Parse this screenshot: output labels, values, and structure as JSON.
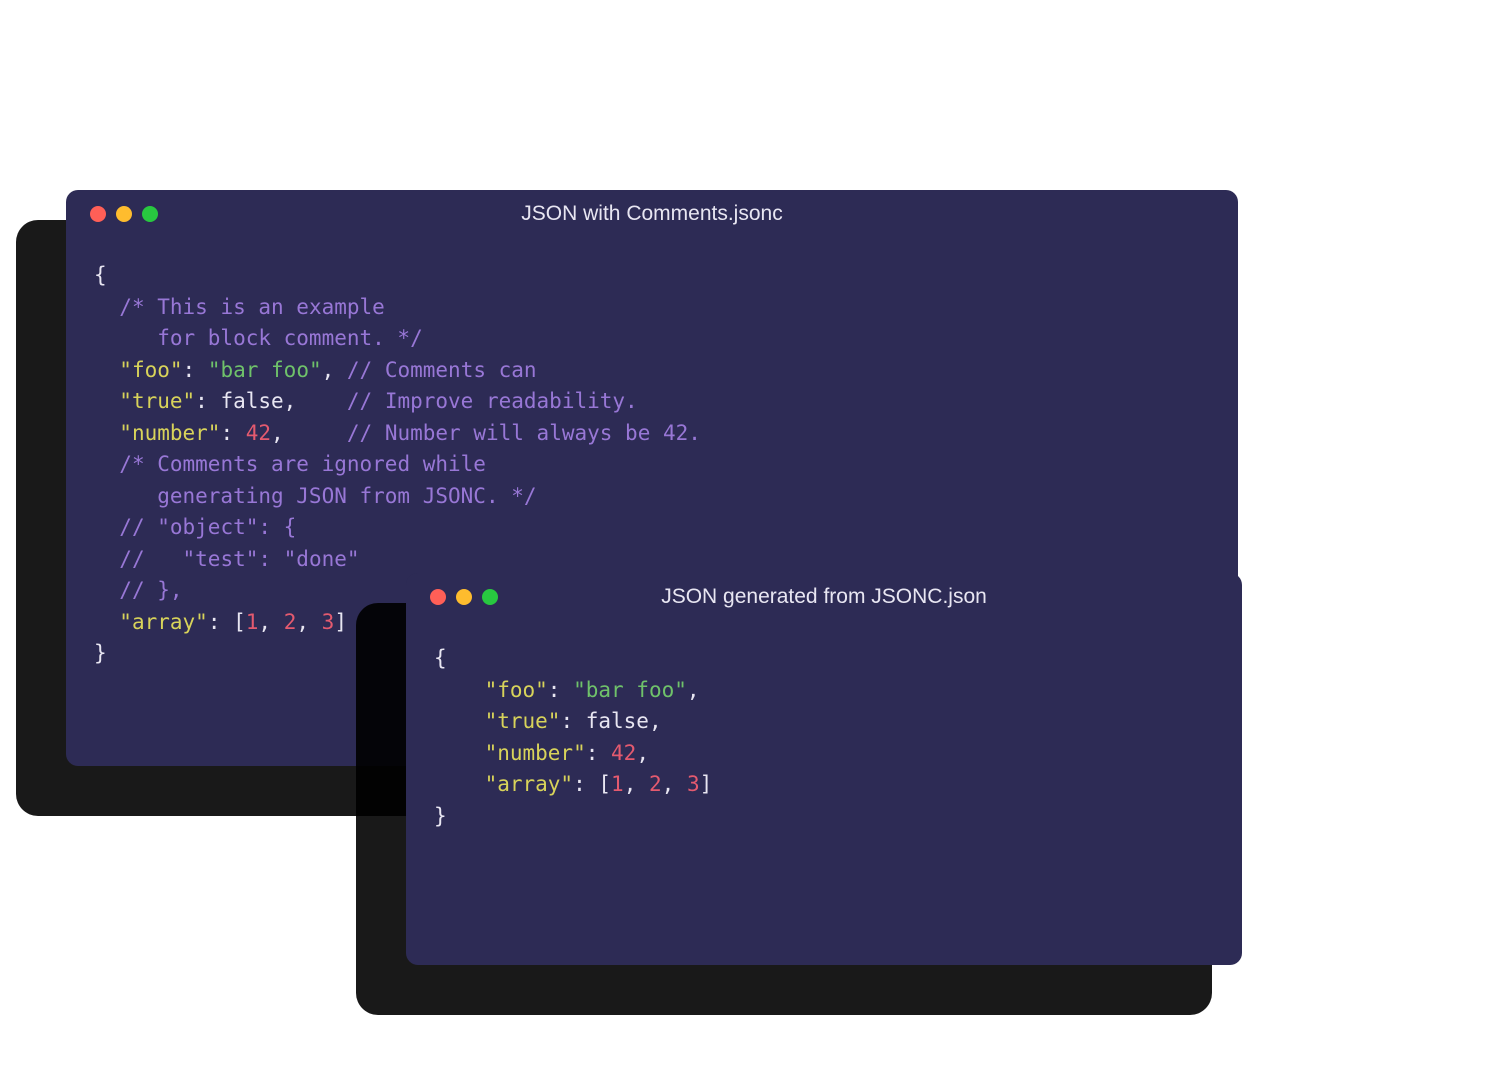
{
  "windows": {
    "back": {
      "title": "JSON with Comments.jsonc",
      "tokens": [
        [
          {
            "c": "t-punct",
            "t": "{"
          }
        ],
        [
          {
            "c": "t-punct",
            "t": "  "
          },
          {
            "c": "t-comment",
            "t": "/* This is an example"
          }
        ],
        [
          {
            "c": "t-punct",
            "t": "     "
          },
          {
            "c": "t-comment",
            "t": "for block comment. */"
          }
        ],
        [
          {
            "c": "t-punct",
            "t": "  "
          },
          {
            "c": "t-key",
            "t": "\"foo\""
          },
          {
            "c": "t-punct",
            "t": ": "
          },
          {
            "c": "t-string",
            "t": "\"bar foo\""
          },
          {
            "c": "t-punct",
            "t": ", "
          },
          {
            "c": "t-comment",
            "t": "// Comments can"
          }
        ],
        [
          {
            "c": "t-punct",
            "t": "  "
          },
          {
            "c": "t-key",
            "t": "\"true\""
          },
          {
            "c": "t-punct",
            "t": ": "
          },
          {
            "c": "t-bool",
            "t": "false"
          },
          {
            "c": "t-punct",
            "t": ",    "
          },
          {
            "c": "t-comment",
            "t": "// Improve readability."
          }
        ],
        [
          {
            "c": "t-punct",
            "t": "  "
          },
          {
            "c": "t-key",
            "t": "\"number\""
          },
          {
            "c": "t-punct",
            "t": ": "
          },
          {
            "c": "t-num",
            "t": "42"
          },
          {
            "c": "t-punct",
            "t": ",     "
          },
          {
            "c": "t-comment",
            "t": "// Number will always be 42."
          }
        ],
        [
          {
            "c": "t-punct",
            "t": "  "
          },
          {
            "c": "t-comment",
            "t": "/* Comments are ignored while"
          }
        ],
        [
          {
            "c": "t-punct",
            "t": "     "
          },
          {
            "c": "t-comment",
            "t": "generating JSON from JSONC. */"
          }
        ],
        [
          {
            "c": "t-punct",
            "t": "  "
          },
          {
            "c": "t-comment",
            "t": "// \"object\": {"
          }
        ],
        [
          {
            "c": "t-punct",
            "t": "  "
          },
          {
            "c": "t-comment",
            "t": "//   \"test\": \"done\""
          }
        ],
        [
          {
            "c": "t-punct",
            "t": "  "
          },
          {
            "c": "t-comment",
            "t": "// },"
          }
        ],
        [
          {
            "c": "t-punct",
            "t": "  "
          },
          {
            "c": "t-key",
            "t": "\"array\""
          },
          {
            "c": "t-punct",
            "t": ": ["
          },
          {
            "c": "t-num",
            "t": "1"
          },
          {
            "c": "t-punct",
            "t": ", "
          },
          {
            "c": "t-num",
            "t": "2"
          },
          {
            "c": "t-punct",
            "t": ", "
          },
          {
            "c": "t-num",
            "t": "3"
          },
          {
            "c": "t-punct",
            "t": "]"
          }
        ],
        [
          {
            "c": "t-punct",
            "t": "}"
          }
        ]
      ]
    },
    "front": {
      "title": "JSON generated from JSONC.json",
      "tokens": [
        [
          {
            "c": "t-punct",
            "t": "{"
          }
        ],
        [
          {
            "c": "t-punct",
            "t": "    "
          },
          {
            "c": "t-key",
            "t": "\"foo\""
          },
          {
            "c": "t-punct",
            "t": ": "
          },
          {
            "c": "t-string",
            "t": "\"bar foo\""
          },
          {
            "c": "t-punct",
            "t": ","
          }
        ],
        [
          {
            "c": "t-punct",
            "t": "    "
          },
          {
            "c": "t-key",
            "t": "\"true\""
          },
          {
            "c": "t-punct",
            "t": ": "
          },
          {
            "c": "t-bool",
            "t": "false"
          },
          {
            "c": "t-punct",
            "t": ","
          }
        ],
        [
          {
            "c": "t-punct",
            "t": "    "
          },
          {
            "c": "t-key",
            "t": "\"number\""
          },
          {
            "c": "t-punct",
            "t": ": "
          },
          {
            "c": "t-num",
            "t": "42"
          },
          {
            "c": "t-punct",
            "t": ","
          }
        ],
        [
          {
            "c": "t-punct",
            "t": "    "
          },
          {
            "c": "t-key",
            "t": "\"array\""
          },
          {
            "c": "t-punct",
            "t": ": ["
          },
          {
            "c": "t-num",
            "t": "1"
          },
          {
            "c": "t-punct",
            "t": ", "
          },
          {
            "c": "t-num",
            "t": "2"
          },
          {
            "c": "t-punct",
            "t": ", "
          },
          {
            "c": "t-num",
            "t": "3"
          },
          {
            "c": "t-punct",
            "t": "]"
          }
        ],
        [
          {
            "c": "t-punct",
            "t": "}"
          }
        ]
      ]
    }
  },
  "colors": {
    "window_bg": "#2d2b55",
    "shadow": "rgba(0,0,0,0.9)",
    "red": "#ff5f57",
    "yellow": "#febc2e",
    "green": "#28c840"
  }
}
